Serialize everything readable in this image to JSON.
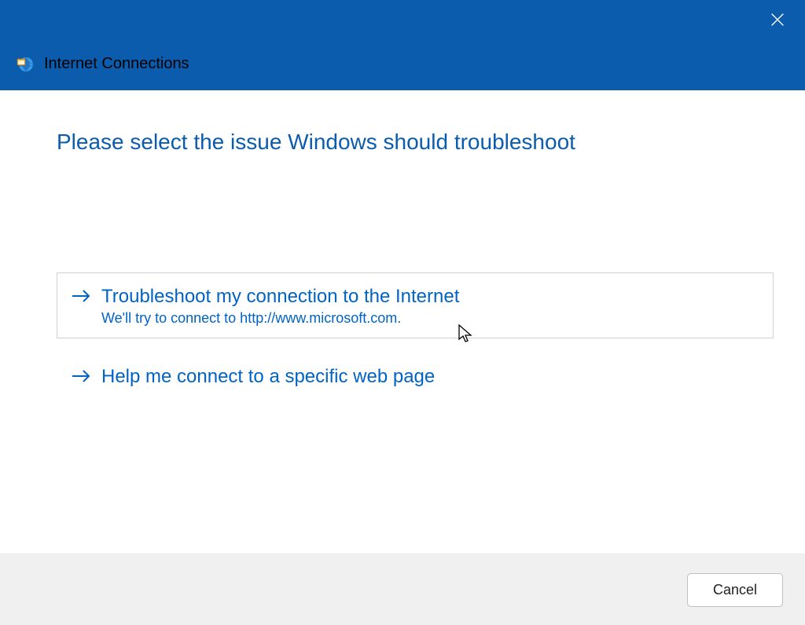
{
  "titlebar": {
    "app_title": "Internet Connections"
  },
  "content": {
    "heading": "Please select the issue Windows should troubleshoot",
    "options": [
      {
        "title": "Troubleshoot my connection to the Internet",
        "subtitle": "We'll try to connect to http://www.microsoft.com."
      },
      {
        "title": "Help me connect to a specific web page",
        "subtitle": ""
      }
    ]
  },
  "footer": {
    "cancel_label": "Cancel"
  }
}
